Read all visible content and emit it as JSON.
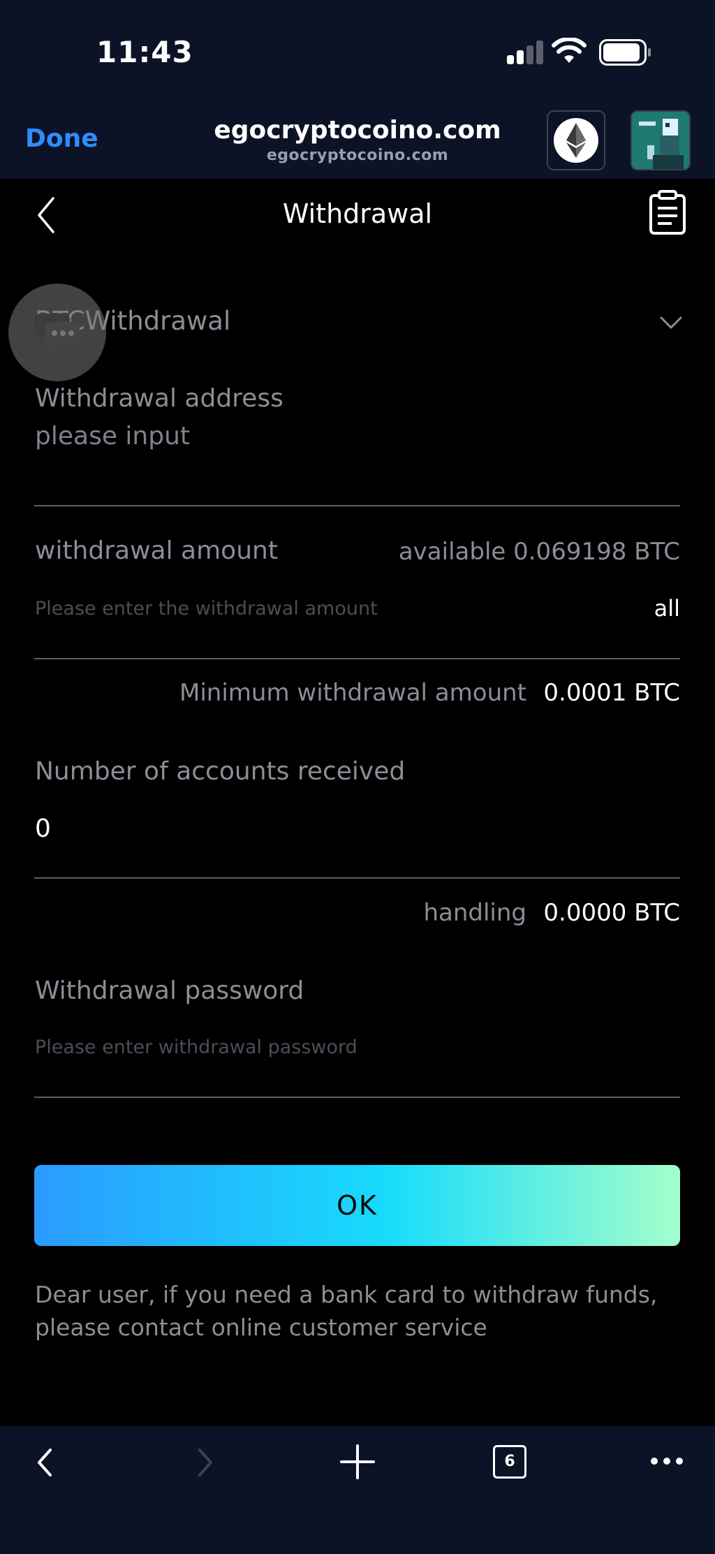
{
  "status_bar": {
    "time": "11:43"
  },
  "browser": {
    "done_label": "Done",
    "site_title": "egocryptocoino.com",
    "site_subtitle": "egocryptocoino.com",
    "tabs_count": "6"
  },
  "header": {
    "title": "Withdrawal"
  },
  "form": {
    "coin_select": "BTCWithdrawal",
    "address_label": "Withdrawal address",
    "address_placeholder": "please input",
    "amount_label": "withdrawal amount",
    "available_text": "available 0.069198 BTC",
    "amount_placeholder": "Please enter the withdrawal amount",
    "all_label": "all",
    "min_label": "Minimum withdrawal amount",
    "min_value": "0.0001 BTC",
    "received_label": "Number of accounts received",
    "received_value": "0",
    "handling_label": "handling",
    "handling_value": "0.0000 BTC",
    "password_label": "Withdrawal password",
    "password_placeholder": "Please enter withdrawal password",
    "ok_label": "OK",
    "notice": "Dear user, if you need a bank card to withdraw funds, please contact online customer service"
  },
  "colors": {
    "chrome_bg": "#0c1326",
    "page_bg": "#000000",
    "link_blue": "#2f8cff",
    "button_gradient_start": "#2a9bff",
    "button_gradient_mid": "#18dcfb",
    "button_gradient_end": "#a4ffcb"
  }
}
